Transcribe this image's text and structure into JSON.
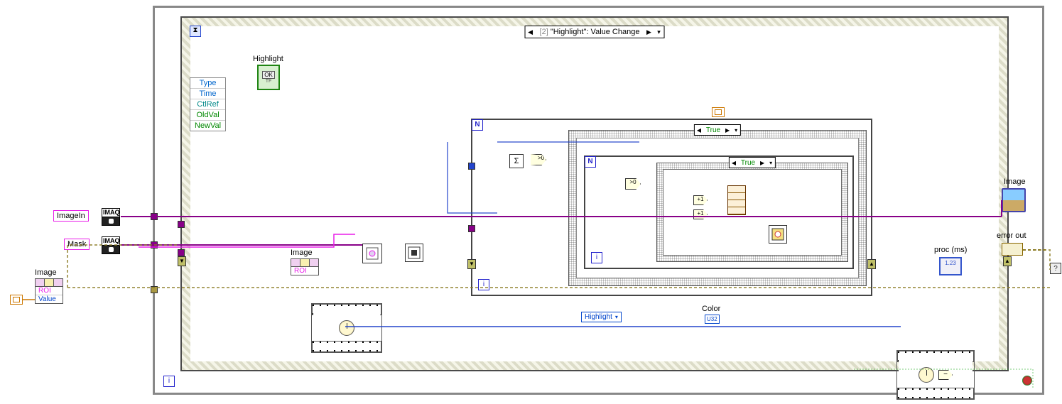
{
  "controls": {
    "image_in_label": "ImageIn",
    "mask_label": "Mask",
    "imaq_text": "IMAQ"
  },
  "prop_node_left": {
    "header_label": "Image",
    "rows": [
      "ROI",
      "Value"
    ]
  },
  "event": {
    "selector_prefix": "[2]",
    "selector_main": "\"Highlight\": Value Change",
    "data_items": [
      {
        "text": "Type",
        "cls": "c-blue"
      },
      {
        "text": "Time",
        "cls": "c-blue"
      },
      {
        "text": "CtlRef",
        "cls": "c-teal"
      },
      {
        "text": "OldVal",
        "cls": "c-green"
      },
      {
        "text": "NewVal",
        "cls": "c-green"
      }
    ],
    "highlight_label": "Highlight",
    "ok_text": "OK"
  },
  "prop_node_image_roi": {
    "header_label": "Image",
    "row": "ROI"
  },
  "case_outer_label": "True",
  "case_inner_label": "True",
  "highlight_ring": "Highlight",
  "color_label": "Color",
  "u32_label": "U32",
  "outputs": {
    "image_label": "Image",
    "error_out_label": "error out",
    "proc_label": "proc (ms)",
    "num_ind_text": "1.23"
  },
  "loop_symbols": {
    "N": "N",
    "i": "i"
  },
  "timeout_symbol": "⌛",
  "run_broken": "?"
}
